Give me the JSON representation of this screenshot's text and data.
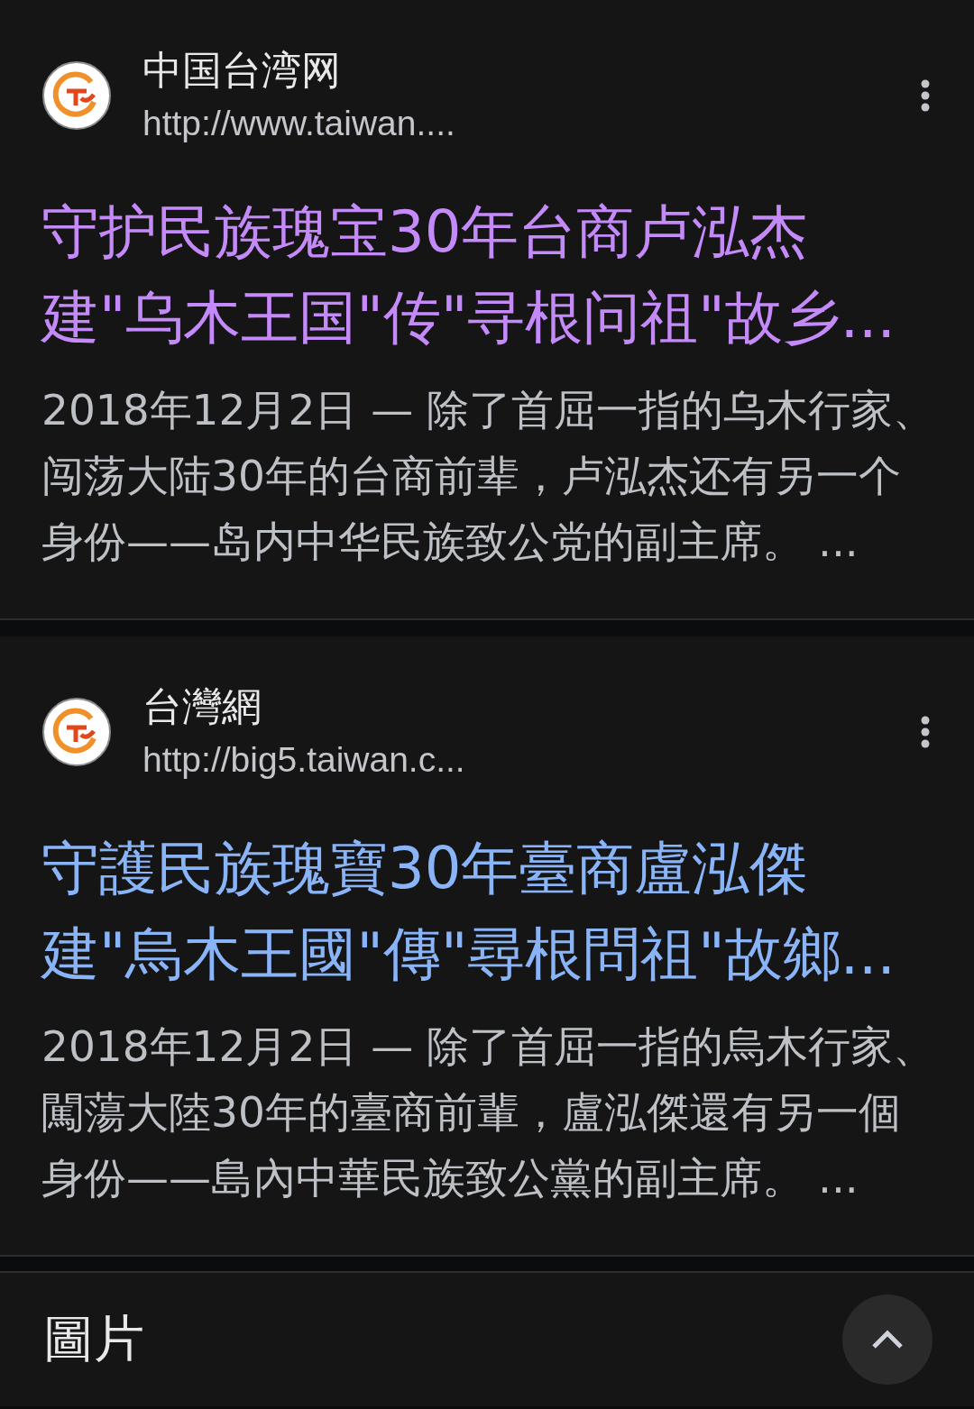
{
  "results": [
    {
      "site_name": "中国台湾网",
      "url": "http://www.taiwan....",
      "title": "守护民族瑰宝30年台商卢泓杰建\"乌木王国\"传\"寻根问祖\"故乡...",
      "visited": true,
      "snippet": "2018年12月2日 — 除了首屈一指的乌木行家、闯荡大陆30年的台商前辈，卢泓杰还有另一个身份——岛内中华民族致公党的副主席。 ..."
    },
    {
      "site_name": "台灣網",
      "url": "http://big5.taiwan.c...",
      "title": "守護民族瑰寶30年臺商盧泓傑建\"烏木王國\"傳\"尋根問祖\"故鄉...",
      "visited": false,
      "snippet": "2018年12月2日 — 除了首屈一指的烏木行家、闖蕩大陸30年的臺商前輩，盧泓傑還有另一個身份——島內中華民族致公黨的副主席。 ..."
    }
  ],
  "images_section": {
    "heading": "圖片"
  }
}
